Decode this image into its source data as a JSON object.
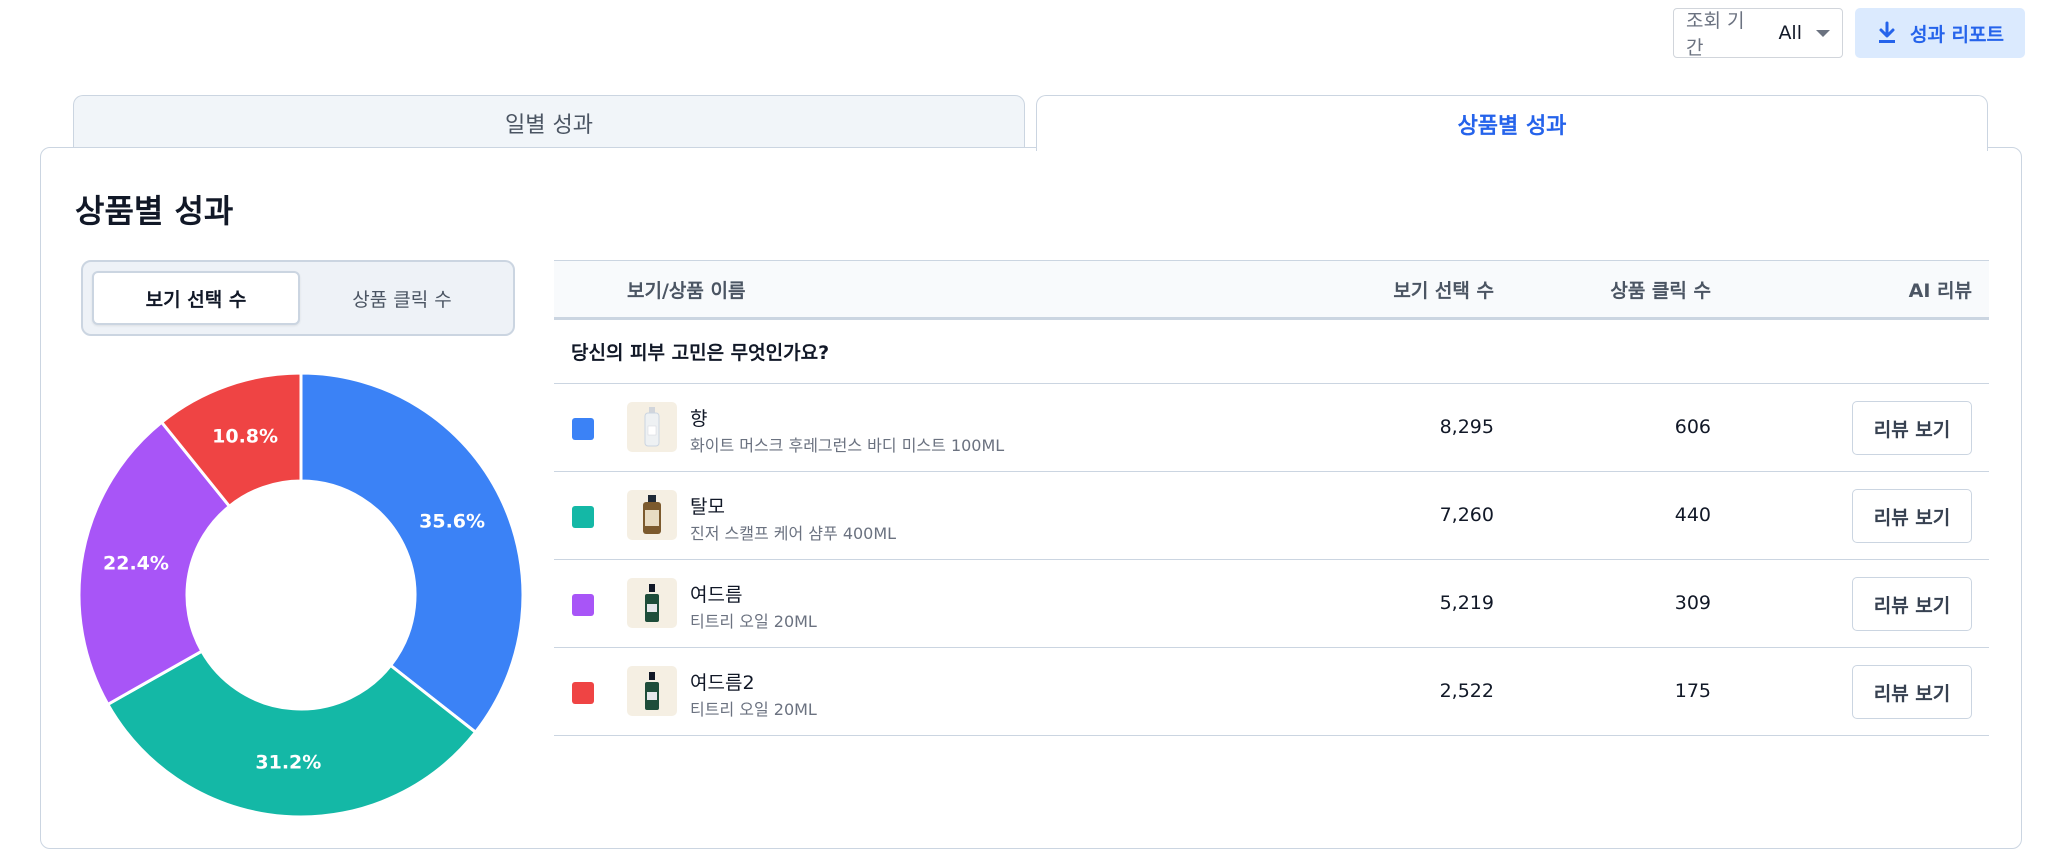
{
  "toolbar": {
    "period_label": "조회 기간",
    "period_value": "All",
    "report_label": "성과 리포트"
  },
  "tabs": [
    {
      "label": "일별 성과",
      "active": false
    },
    {
      "label": "상품별 성과",
      "active": true
    }
  ],
  "panel": {
    "title": "상품별 성과",
    "toggle": [
      {
        "label": "보기 선택 수",
        "active": true
      },
      {
        "label": "상품 클릭 수",
        "active": false
      }
    ]
  },
  "table": {
    "columns": [
      "보기/상품 이름",
      "보기 선택 수",
      "상품 클릭 수",
      "AI 리뷰"
    ],
    "group": "당신의 피부 고민은 무엇인가요?",
    "rows": [
      {
        "category": "향",
        "product": "화이트 머스크 후레그런스 바디 미스트 100ML",
        "views": "8,295",
        "clicks": "606",
        "action": "리뷰 보기",
        "color": "#3b82f6",
        "icon": "mist-bottle-icon"
      },
      {
        "category": "탈모",
        "product": "진저 스캘프 케어 샴푸 400ML",
        "views": "7,260",
        "clicks": "440",
        "action": "리뷰 보기",
        "color": "#14b8a6",
        "icon": "shampoo-bottle-icon"
      },
      {
        "category": "여드름",
        "product": "티트리 오일 20ML",
        "views": "5,219",
        "clicks": "309",
        "action": "리뷰 보기",
        "color": "#a855f7",
        "icon": "oil-bottle-icon"
      },
      {
        "category": "여드름2",
        "product": "티트리 오일 20ML",
        "views": "2,522",
        "clicks": "175",
        "action": "리뷰 보기",
        "color": "#ef4444",
        "icon": "oil-bottle-icon"
      }
    ]
  },
  "chart_data": {
    "type": "pie",
    "variant": "donut",
    "categories": [
      "향",
      "탈모",
      "여드름",
      "여드름2"
    ],
    "values": [
      35.6,
      31.2,
      22.4,
      10.8
    ],
    "labels": [
      "35.6%",
      "31.2%",
      "22.4%",
      "10.8%"
    ],
    "colors": [
      "#3b82f6",
      "#14b8a6",
      "#a855f7",
      "#ef4444"
    ]
  }
}
